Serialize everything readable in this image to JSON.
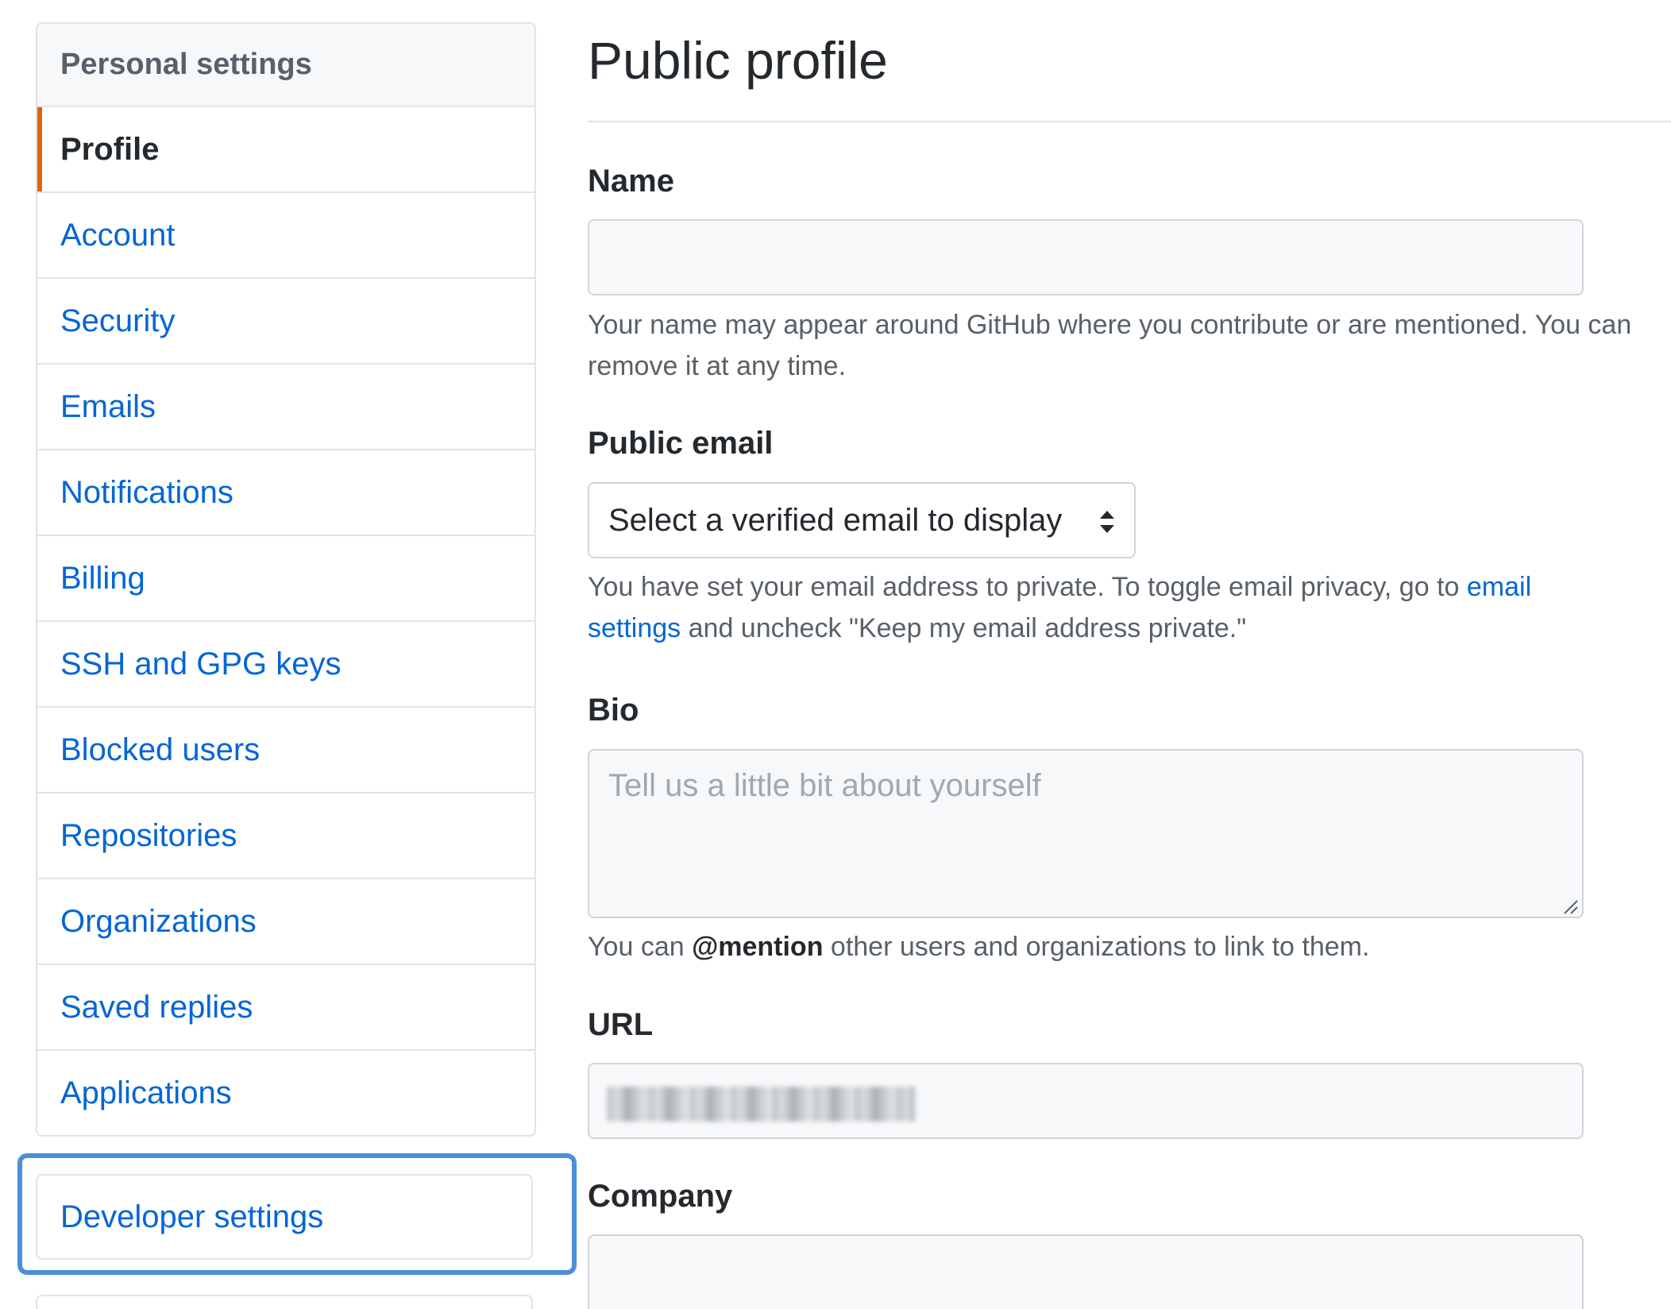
{
  "sidebar": {
    "header": "Personal settings",
    "items": [
      {
        "label": "Profile",
        "selected": true
      },
      {
        "label": "Account"
      },
      {
        "label": "Security"
      },
      {
        "label": "Emails"
      },
      {
        "label": "Notifications"
      },
      {
        "label": "Billing"
      },
      {
        "label": "SSH and GPG keys"
      },
      {
        "label": "Blocked users"
      },
      {
        "label": "Repositories"
      },
      {
        "label": "Organizations"
      },
      {
        "label": "Saved replies"
      },
      {
        "label": "Applications"
      }
    ],
    "developer_settings": "Developer settings"
  },
  "main": {
    "title": "Public profile",
    "name": {
      "label": "Name",
      "value": "",
      "note": "Your name may appear around GitHub where you contribute or are mentioned. You can remove it at any time."
    },
    "public_email": {
      "label": "Public email",
      "selected": "Select a verified email to display",
      "note_prefix": "You have set your email address to private. To toggle email privacy, go to ",
      "note_link": "email settings",
      "note_suffix": " and uncheck \"Keep my email address private.\""
    },
    "bio": {
      "label": "Bio",
      "placeholder": "Tell us a little bit about yourself",
      "note_prefix": "You can ",
      "note_bold": "@mention",
      "note_suffix": " other users and organizations to link to them."
    },
    "url": {
      "label": "URL"
    },
    "company": {
      "label": "Company",
      "value": ""
    }
  },
  "colors": {
    "link": "#0366d6",
    "selected_marker": "#e36209",
    "highlight": "#4a90d9"
  }
}
